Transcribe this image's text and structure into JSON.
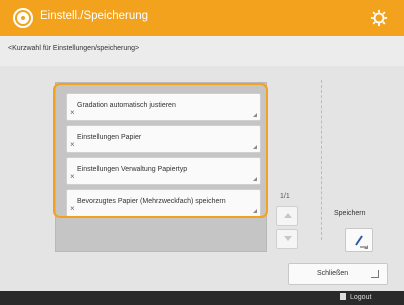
{
  "header": {
    "title": "Einstell./Speicherung"
  },
  "subheader": {
    "text": "<Kurzwahl für Einstellungen/speicherung>"
  },
  "list": {
    "items": [
      {
        "label": "Gradation automatisch justieren"
      },
      {
        "label": "Einstellungen Papier"
      },
      {
        "label": "Einstellungen Verwaltung Papiertyp"
      },
      {
        "label": "Bevorzugtes Papier (Mehrzweckfach) speichern"
      }
    ],
    "page_indicator": "1/1"
  },
  "actions": {
    "save_label": "Speichern",
    "close_label": "Schließen"
  },
  "footer": {
    "logout_label": "Logout"
  },
  "colors": {
    "accent": "#f2a21c",
    "header_text": "#ffffff",
    "footer_bg": "#2a2a2a"
  }
}
